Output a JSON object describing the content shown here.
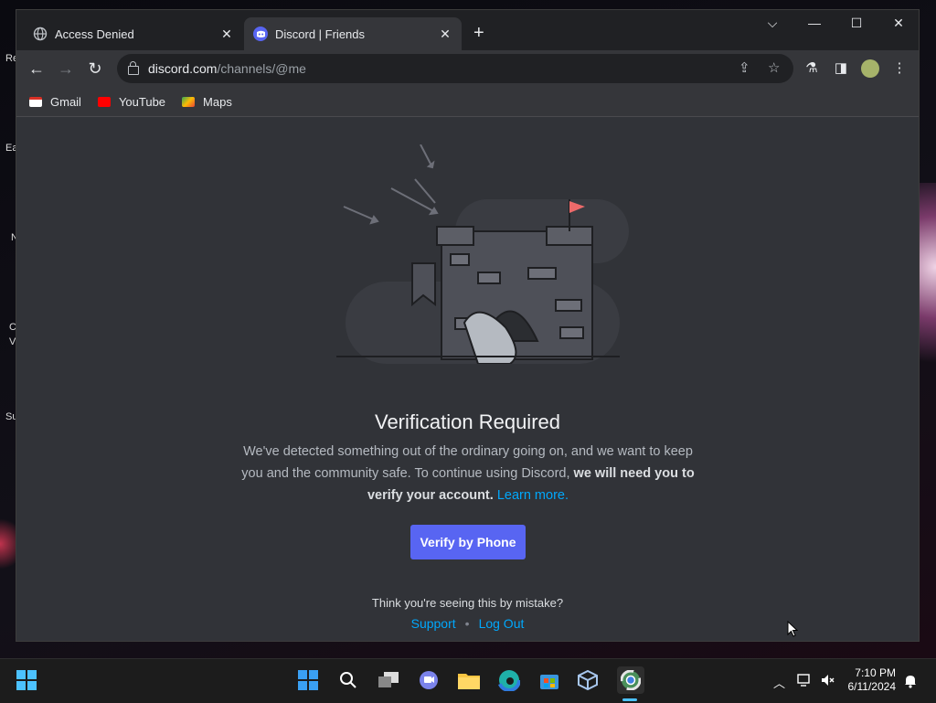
{
  "desktop": {
    "icon_texts": [
      "Re",
      "Ea",
      "N",
      "C",
      "V",
      "Su"
    ]
  },
  "browser": {
    "tabs": [
      {
        "title": "Access Denied",
        "icon": "globe-icon"
      },
      {
        "title": "Discord | Friends",
        "icon": "discord-icon"
      }
    ],
    "new_tab_glyph": "+",
    "url_host": "discord.com",
    "url_path": "/channels/@me",
    "bookmarks": [
      {
        "label": "Gmail",
        "color": "#d93025"
      },
      {
        "label": "YouTube",
        "color": "#ff0000"
      },
      {
        "label": "Maps",
        "color": "#34a853"
      }
    ]
  },
  "page": {
    "heading": "Verification Required",
    "desc_part1": "We've detected something out of the ordinary going on, and we want to keep you and the community safe. To continue using Discord, ",
    "desc_bold": "we will need you to verify your account.",
    "desc_link": "Learn more.",
    "verify_button": "Verify by Phone",
    "mistake_text": "Think you're seeing this by mistake?",
    "support_link": "Support",
    "separator": "•",
    "logout_link": "Log Out",
    "accent": "#5865f2",
    "link_color": "#00a8fc"
  },
  "taskbar": {
    "time": "7:10 PM",
    "date": "6/11/2024"
  }
}
